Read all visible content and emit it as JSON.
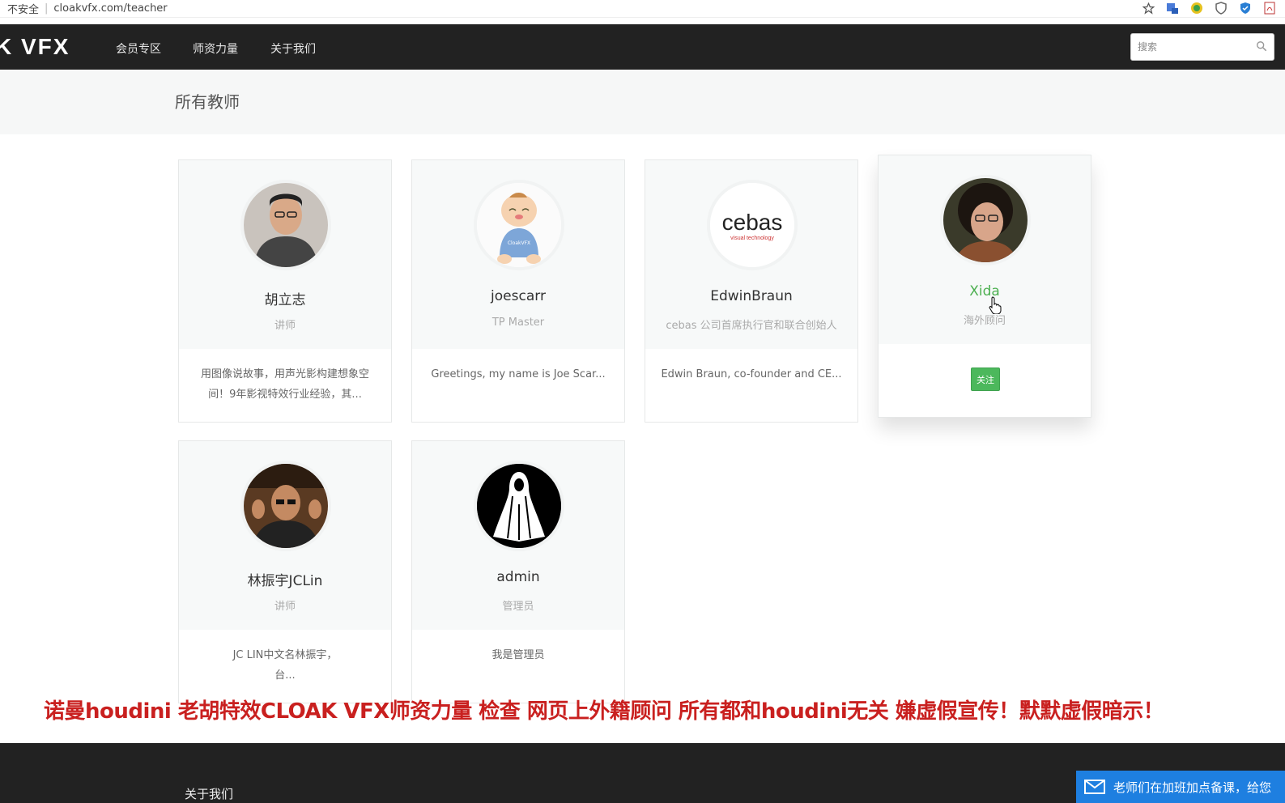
{
  "browser": {
    "security_label": "不安全",
    "url": "cloakvfx.com/teacher"
  },
  "navbar": {
    "brand": "K VFX",
    "items": [
      {
        "label": "会员专区"
      },
      {
        "label": "师资力量"
      },
      {
        "label": "关于我们"
      }
    ],
    "search_placeholder": "搜索"
  },
  "page": {
    "title": "所有教师"
  },
  "teachers": [
    {
      "name": "胡立志",
      "role": "讲师",
      "desc_line1": "用图像说故事，用声光影构建想象空",
      "desc_line2": "间！9年影视特效行业经验，其..."
    },
    {
      "name": "joescarr",
      "role": "TP Master",
      "desc_line1": "Greetings, my name is Joe Scar...",
      "desc_line2": ""
    },
    {
      "name": "EdwinBraun",
      "role": "cebas 公司首席执行官和联合创始人",
      "desc_line1": "Edwin Braun, co-founder and CE...",
      "desc_line2": ""
    },
    {
      "name": "Xida",
      "role": "海外顾问",
      "button": "关注"
    },
    {
      "name": "林振宇JCLin",
      "role": "讲师",
      "desc_line1": "JC LIN中文名林振宇，",
      "desc_line2": "台..."
    },
    {
      "name": "admin",
      "role": "管理员",
      "desc_line1": "我是管理员",
      "desc_line2": ""
    }
  ],
  "logo_text": {
    "cebas_main": "cebas",
    "cebas_sub": "visual technology",
    "baby_badge": "CloakVFX"
  },
  "overlay_caption": "诺曼houdini   老胡特效CLOAK VFX师资力量  检查   网页上外籍顾问 所有都和houdini无关  嫌虚假宣传！默默虚假暗示！",
  "footer": {
    "about": "关于我们",
    "notice": "老师们在加班加点备课，给您"
  },
  "colors": {
    "navbar_bg": "#222222",
    "accent_green": "#4cb85c",
    "caption_red": "#c9201f",
    "notice_blue": "#1e7fe0"
  }
}
